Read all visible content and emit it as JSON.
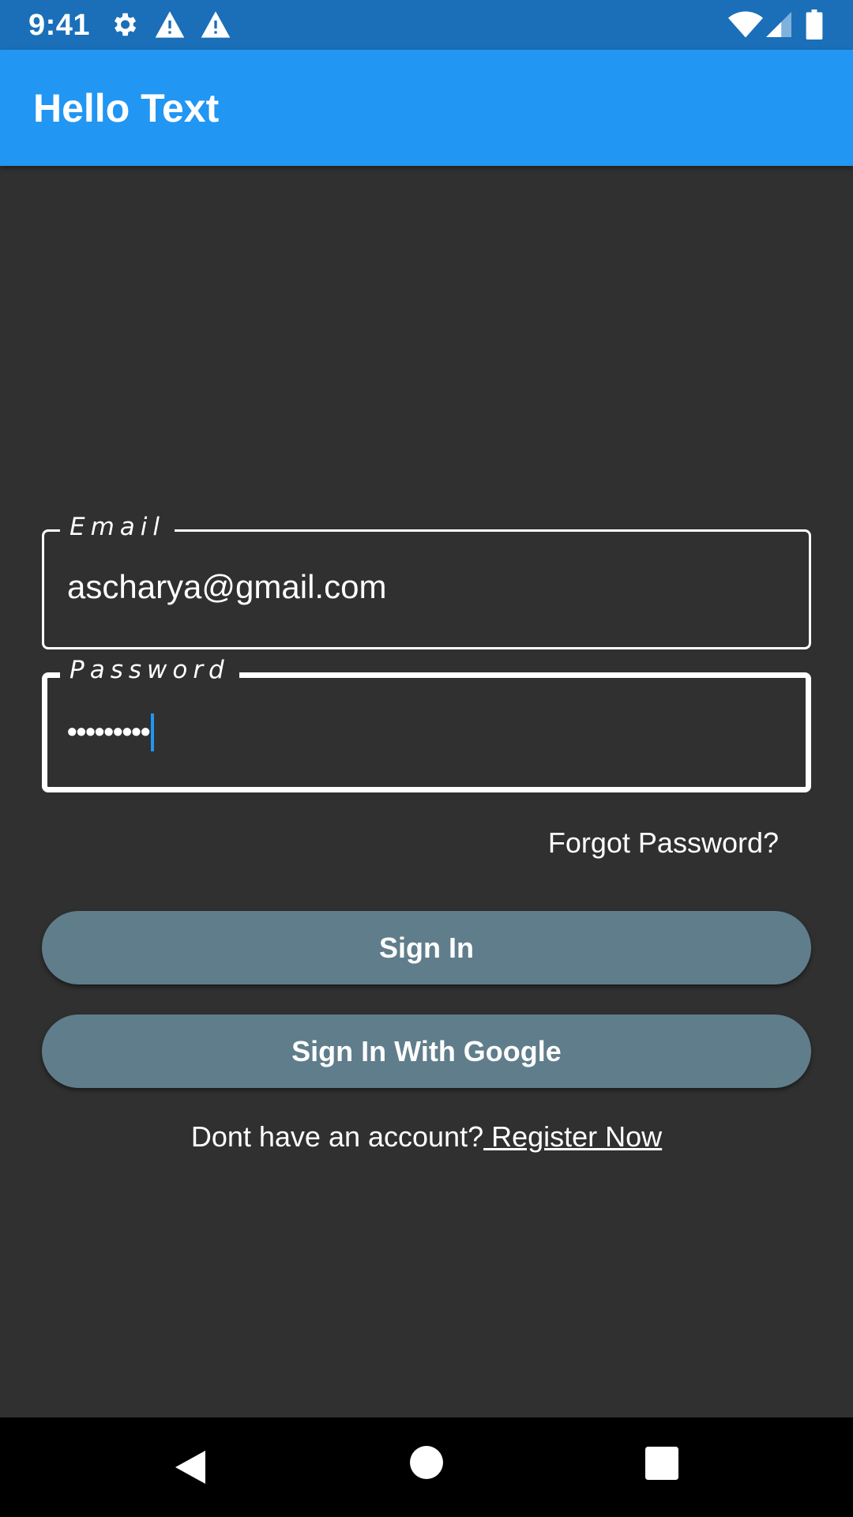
{
  "status_bar": {
    "time": "9:41",
    "icons_left": [
      "gear-icon",
      "warning-icon",
      "warning-icon"
    ],
    "icons_right": [
      "wifi-icon",
      "cell-signal-icon",
      "battery-icon"
    ],
    "color": "#1a6fb8"
  },
  "app_bar": {
    "title": "Hello Text",
    "color": "#2196f3"
  },
  "form": {
    "email": {
      "label": "Email",
      "value": "ascharya@gmail.com"
    },
    "password": {
      "label": "Password",
      "masked_value": "•••••••••",
      "focused": true
    },
    "forgot_password": "Forgot Password?",
    "sign_in_button": "Sign In",
    "google_button": "Sign In With Google",
    "register_prompt": "Dont have an account?",
    "register_link": " Register Now"
  },
  "theme": {
    "background": "#303030",
    "button": "#607d8b",
    "accent": "#2196f3"
  },
  "nav_bar": {
    "buttons": [
      "back-icon",
      "home-icon",
      "recents-icon"
    ]
  }
}
